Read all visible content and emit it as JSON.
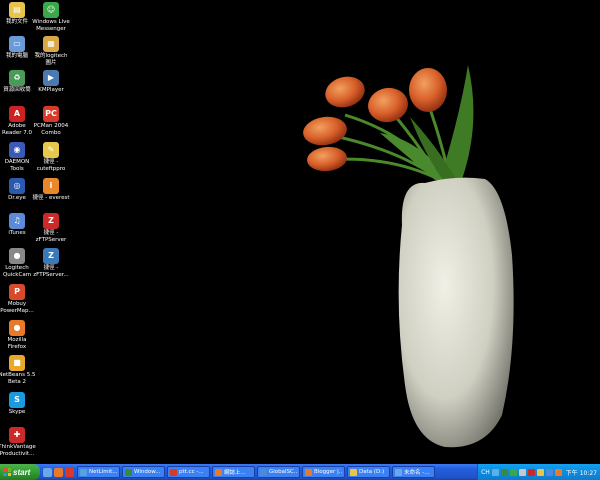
{
  "desktop": {
    "icons": [
      {
        "label": "我的文件",
        "icon": "my-documents-icon",
        "glyph": "▤",
        "color": "#e8c44a"
      },
      {
        "label": "Windows Live Messenger",
        "icon": "messenger-icon",
        "glyph": "☺",
        "color": "#3aa848"
      },
      {
        "label": "我的電腦",
        "icon": "my-computer-icon",
        "glyph": "▭",
        "color": "#6a9ad8"
      },
      {
        "label": "我的logitech 圖片",
        "icon": "logitech-pictures-icon",
        "glyph": "▦",
        "color": "#d8a848"
      },
      {
        "label": "資源回收筒",
        "icon": "recycle-bin-icon",
        "glyph": "♻",
        "color": "#4a9a5a"
      },
      {
        "label": "KMPlayer",
        "icon": "kmplayer-icon",
        "glyph": "▶",
        "color": "#4a7ab0"
      },
      {
        "label": "Adobe Reader 7.0",
        "icon": "adobe-reader-icon",
        "glyph": "A",
        "color": "#cc2222"
      },
      {
        "label": "PCMan 2004 Combo",
        "icon": "pcman-icon",
        "glyph": "PC",
        "color": "#d83a2a"
      },
      {
        "label": "DAEMON Tools",
        "icon": "daemon-tools-icon",
        "glyph": "◉",
        "color": "#3a5ab8"
      },
      {
        "label": "捷徑 - cuteftppro",
        "icon": "cuteftp-icon",
        "glyph": "✎",
        "color": "#e8c84a"
      },
      {
        "label": "Dr.eye",
        "icon": "dreye-icon",
        "glyph": "◎",
        "color": "#2a5ab0"
      },
      {
        "label": "捷徑 - everest",
        "icon": "everest-icon",
        "glyph": "i",
        "color": "#e8882a"
      },
      {
        "label": "iTunes",
        "icon": "itunes-icon",
        "glyph": "♫",
        "color": "#5a8ad8"
      },
      {
        "label": "捷徑 - zFTPServer",
        "icon": "zftpserver-icon",
        "glyph": "Z",
        "color": "#cc2a2a"
      },
      {
        "label": "Logitech QuickCam",
        "icon": "quickcam-icon",
        "glyph": "●",
        "color": "#888888"
      },
      {
        "label": "捷徑 - zFTPServer...",
        "icon": "zftpserver-2-icon",
        "glyph": "Z",
        "color": "#3a7ab8"
      },
      {
        "label": "Mobuy PowerMap...",
        "icon": "powermap-icon",
        "glyph": "P",
        "color": "#d84a2a"
      },
      {
        "label": "Mozilla Firefox",
        "icon": "firefox-icon",
        "glyph": "●",
        "color": "#e8782a"
      },
      {
        "label": "NetBeans 5.5 Beta 2",
        "icon": "netbeans-icon",
        "glyph": "■",
        "color": "#e8a82a"
      },
      {
        "label": "Skype",
        "icon": "skype-icon",
        "glyph": "S",
        "color": "#1a9ae0"
      },
      {
        "label": "ThinkVantage Productivit...",
        "icon": "thinkvantage-icon",
        "glyph": "✚",
        "color": "#cc2a2a"
      }
    ]
  },
  "taskbar": {
    "start_label": "start",
    "quick_launch": [
      {
        "icon": "show-desktop-icon",
        "color": "#6aa8e8"
      },
      {
        "icon": "firefox-quicklaunch-icon",
        "color": "#e8782a"
      },
      {
        "icon": "pcman-quicklaunch-icon",
        "color": "#d83a2a"
      }
    ],
    "tasks": [
      {
        "label": "NetLimit...",
        "icon": "netlimit-icon",
        "color": "#5aa0e0"
      },
      {
        "label": "Window...",
        "icon": "window-icon",
        "color": "#3a8a3a"
      },
      {
        "label": "ptt.cc -...",
        "icon": "ptt-icon",
        "color": "#d83a2a"
      },
      {
        "label": "網誌上...",
        "icon": "blog-icon",
        "color": "#e8782a"
      },
      {
        "label": "GlobalSC...",
        "icon": "globalsc-icon",
        "color": "#4a8ad8"
      },
      {
        "label": "Blogger |...",
        "icon": "blogger-icon",
        "color": "#e8782a"
      },
      {
        "label": "Data (D:)",
        "icon": "folder-icon",
        "color": "#e8c44a"
      },
      {
        "label": "未命名 -...",
        "icon": "paint-icon",
        "color": "#6aa8e8"
      }
    ],
    "tray": {
      "language": "CH",
      "clock": "下午 10:27",
      "icons": [
        {
          "icon": "help-tray-icon",
          "color": "#5ab0e8"
        },
        {
          "icon": "network-tray-icon",
          "color": "#3a8a3a"
        },
        {
          "icon": "messenger-tray-icon",
          "color": "#3aa848"
        },
        {
          "icon": "volume-tray-icon",
          "color": "#c8c8c8"
        },
        {
          "icon": "antivirus-tray-icon",
          "color": "#cc2a2a"
        },
        {
          "icon": "monitor-tray-icon",
          "color": "#e8c44a"
        },
        {
          "icon": "update-tray-icon",
          "color": "#4a8ad8"
        },
        {
          "icon": "security-tray-icon",
          "color": "#e87a2a"
        }
      ]
    }
  }
}
